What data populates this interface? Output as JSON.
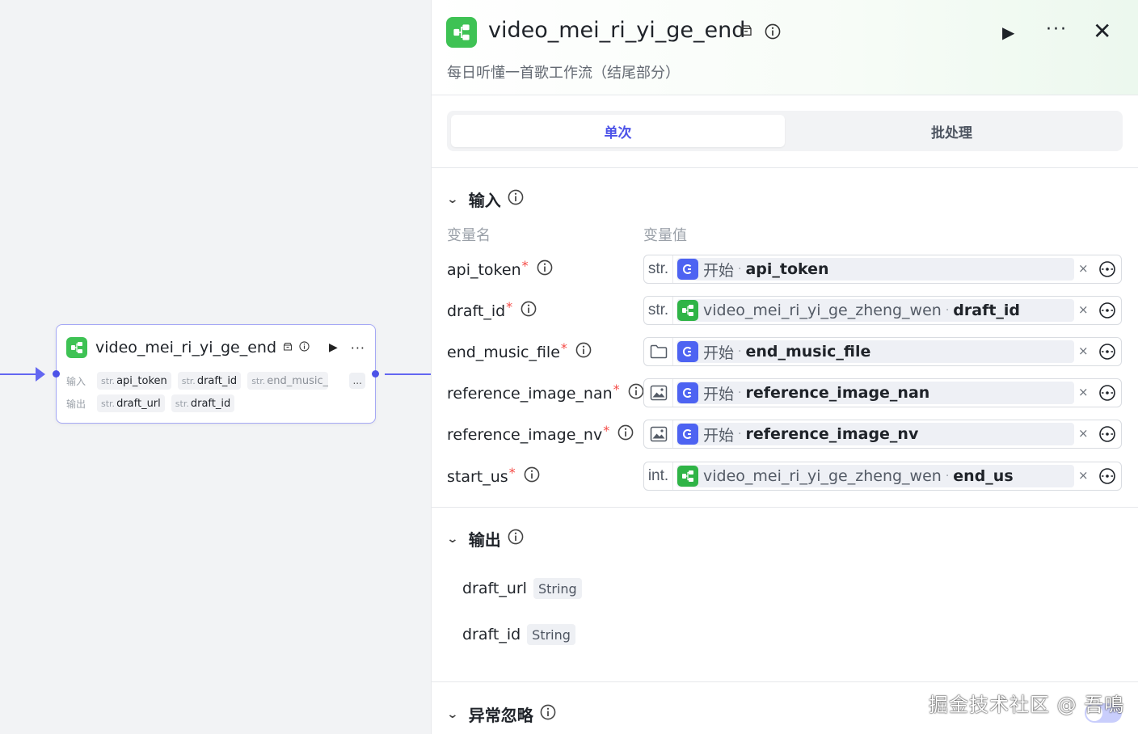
{
  "canvas": {
    "node": {
      "title": "video_mei_ri_yi_ge_end",
      "input_label": "输入",
      "output_label": "输出",
      "inputs": [
        {
          "type": "str.",
          "name": "api_token"
        },
        {
          "type": "str.",
          "name": "draft_id"
        },
        {
          "type": "str.",
          "name": "end_music_"
        }
      ],
      "outputs": [
        {
          "type": "str.",
          "name": "draft_url"
        },
        {
          "type": "str.",
          "name": "draft_id"
        }
      ],
      "more_label": "..."
    }
  },
  "panel": {
    "title": "video_mei_ri_yi_ge_end",
    "description": "每日听懂一首歌工作流（结尾部分）",
    "tabs": [
      {
        "label": "单次",
        "active": true
      },
      {
        "label": "批处理",
        "active": false
      }
    ],
    "input_section": {
      "title": "输入",
      "col_name": "变量名",
      "col_value": "变量值",
      "rows": [
        {
          "name": "api_token",
          "type": "str.",
          "source_icon": "start",
          "source_node": "开始",
          "source_var": "api_token"
        },
        {
          "name": "draft_id",
          "type": "str.",
          "source_icon": "workflow",
          "source_node": "video_mei_ri_yi_ge_zheng_wen",
          "source_var": "draft_id"
        },
        {
          "name": "end_music_file",
          "type": "folder-icon",
          "source_icon": "start",
          "source_node": "开始",
          "source_var": "end_music_file"
        },
        {
          "name": "reference_image_nan",
          "type": "image-icon",
          "source_icon": "start",
          "source_node": "开始",
          "source_var": "reference_image_nan"
        },
        {
          "name": "reference_image_nv",
          "type": "image-icon",
          "source_icon": "start",
          "source_node": "开始",
          "source_var": "reference_image_nv"
        },
        {
          "name": "start_us",
          "type": "int.",
          "source_icon": "workflow",
          "source_node": "video_mei_ri_yi_ge_zheng_wen",
          "source_var": "end_us"
        }
      ],
      "required_mark": "*",
      "separator": "·",
      "clear_mark": "×"
    },
    "output_section": {
      "title": "输出",
      "rows": [
        {
          "name": "draft_url",
          "type": "String"
        },
        {
          "name": "draft_id",
          "type": "String"
        }
      ]
    },
    "exception_section": {
      "title": "异常忽略"
    },
    "watermark": "掘金技术社区 @ 吾鳴"
  },
  "colors": {
    "accent": "#4d53e8",
    "workflow_green": "#3ec254",
    "start_blue": "#4d63f2",
    "required_red": "#f54a45"
  }
}
